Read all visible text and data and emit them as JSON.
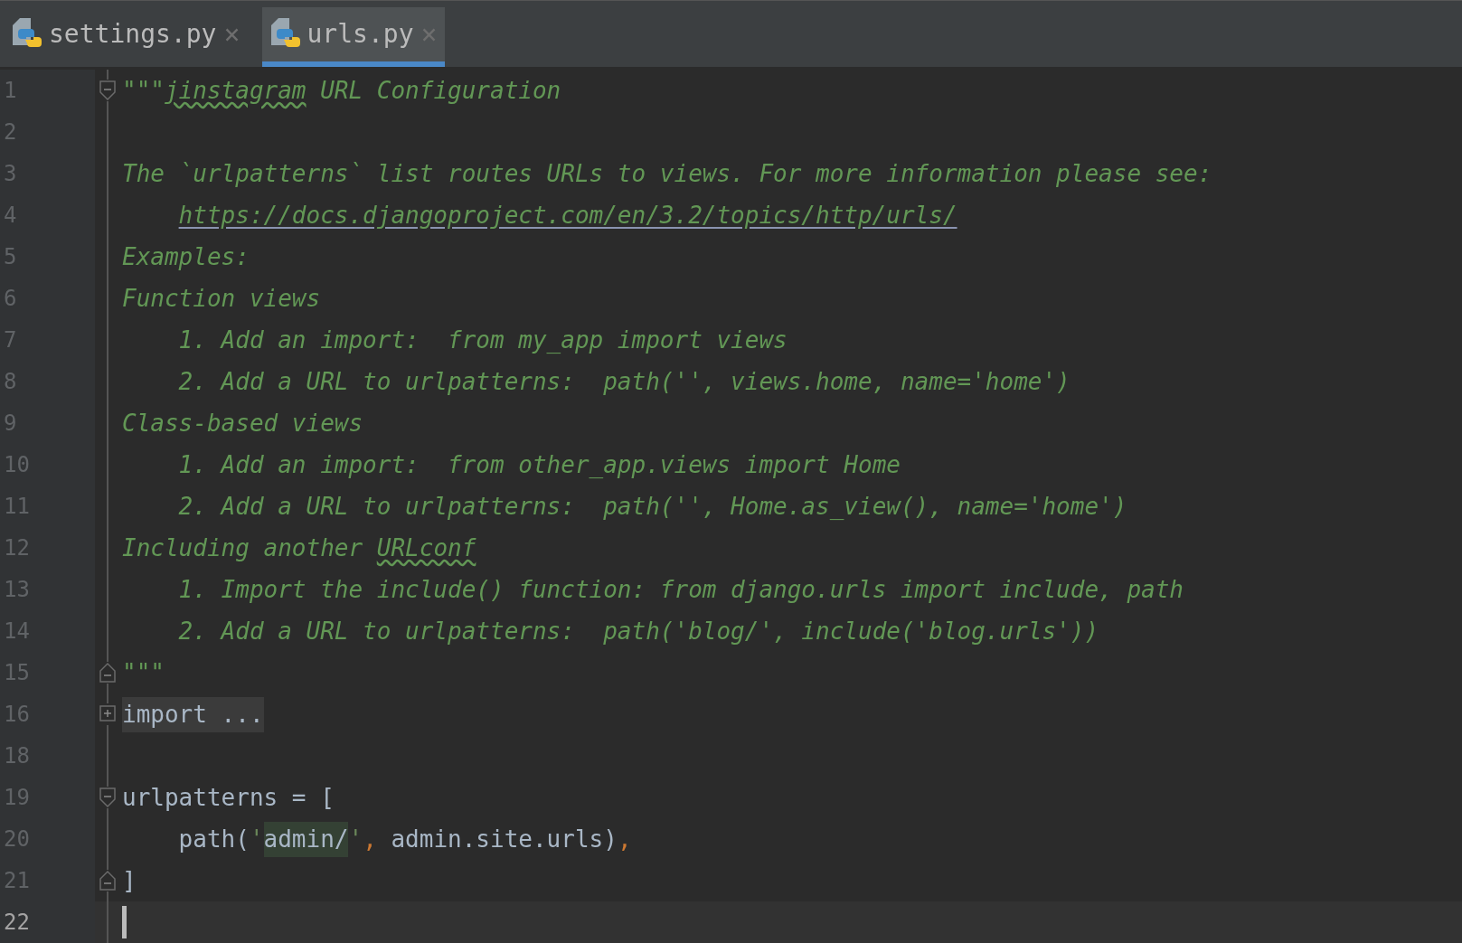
{
  "tabs": [
    {
      "label": "settings.py",
      "close": "×",
      "selected": false
    },
    {
      "label": "urls.py",
      "close": "×",
      "selected": true
    }
  ],
  "lines": [
    {
      "number": "1",
      "fold": {
        "kind": "start"
      },
      "segments": [
        {
          "kind": "doc",
          "text": "\"\"\""
        },
        {
          "kind": "typo",
          "text": "jinstagram"
        },
        {
          "kind": "doc",
          "text": " URL Configuration"
        }
      ]
    },
    {
      "number": "2"
    },
    {
      "number": "3",
      "segments": [
        {
          "kind": "doc",
          "text": "The `urlpatterns` list routes URLs to views. For more information please see:"
        }
      ]
    },
    {
      "number": "4",
      "segments": [
        {
          "kind": "link",
          "indented": true,
          "text": "https://docs.djangoproject.com/en/3.2/topics/http/urls/"
        }
      ]
    },
    {
      "number": "5",
      "segments": [
        {
          "kind": "doc",
          "text": "Examples:"
        }
      ]
    },
    {
      "number": "6",
      "segments": [
        {
          "kind": "doc",
          "text": "Function views"
        }
      ]
    },
    {
      "number": "7",
      "segments": [
        {
          "kind": "doc",
          "text": "    1. Add an import:  from my_app import views"
        }
      ]
    },
    {
      "number": "8",
      "segments": [
        {
          "kind": "doc",
          "text": "    2. Add a URL to urlpatterns:  path('', views.home, name='home')"
        }
      ]
    },
    {
      "number": "9",
      "segments": [
        {
          "kind": "doc",
          "text": "Class-based views"
        }
      ]
    },
    {
      "number": "10",
      "segments": [
        {
          "kind": "doc",
          "text": "    1. Add an import:  from other_app.views import Home"
        }
      ]
    },
    {
      "number": "11",
      "segments": [
        {
          "kind": "doc",
          "text": "    2. Add a URL to urlpatterns:  path('', Home.as_view(), name='home')"
        }
      ]
    },
    {
      "number": "12",
      "segments": [
        {
          "kind": "doc",
          "text": "Including another "
        },
        {
          "kind": "typo",
          "text": "URLconf"
        }
      ]
    },
    {
      "number": "13",
      "segments": [
        {
          "kind": "doc",
          "text": "    1. Import the include() function: from django.urls import include, path"
        }
      ]
    },
    {
      "number": "14",
      "segments": [
        {
          "kind": "doc",
          "text": "    2. Add a URL to urlpatterns:  path('blog/', include('blog.urls'))"
        }
      ]
    },
    {
      "number": "15",
      "fold": {
        "kind": "end"
      },
      "segments": [
        {
          "kind": "doc",
          "text": "\"\"\""
        }
      ]
    },
    {
      "number": "16",
      "fold": {
        "kind": "collapsed"
      },
      "segments": [
        {
          "kind": "folded",
          "text": "import ..."
        }
      ]
    },
    {
      "number": "18"
    },
    {
      "number": "19",
      "fold": {
        "kind": "start"
      },
      "segments": [
        {
          "kind": "code",
          "text": "urlpatterns = ["
        }
      ]
    },
    {
      "number": "20",
      "segments": [
        {
          "kind": "code",
          "text": "    path("
        },
        {
          "kind": "string",
          "text": "'"
        },
        {
          "kind": "string_match",
          "text": "admin/"
        },
        {
          "kind": "string",
          "text": "'"
        },
        {
          "kind": "punct",
          "text": ","
        },
        {
          "kind": "code",
          "text": " admin.site.urls)"
        },
        {
          "kind": "punct",
          "text": ","
        }
      ]
    },
    {
      "number": "21",
      "fold": {
        "kind": "end"
      },
      "segments": [
        {
          "kind": "code",
          "text": "]"
        }
      ]
    },
    {
      "number": "22",
      "current": true
    }
  ]
}
